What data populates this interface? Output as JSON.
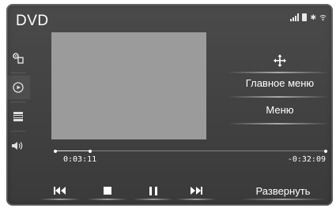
{
  "header": {
    "title": "DVD"
  },
  "status_icons": [
    "signal-icon",
    "battery-icon",
    "bluetooth-icon",
    "wifi-icon"
  ],
  "sidebar": {
    "items": [
      {
        "icon": "source-settings-icon",
        "active": false
      },
      {
        "icon": "play-disc-icon",
        "active": true
      },
      {
        "icon": "equalizer-icon",
        "active": false
      },
      {
        "icon": "volume-icon",
        "active": false
      }
    ]
  },
  "menu": {
    "move_icon": "move-arrows-icon",
    "main_menu_label": "Главное меню",
    "menu_label": "Меню"
  },
  "playback": {
    "elapsed": "0:03:11",
    "remaining": "-0:32:09",
    "progress_fraction": 0.13
  },
  "controls": {
    "prev_icon": "previous-track-icon",
    "stop_icon": "stop-icon",
    "pause_icon": "pause-icon",
    "next_icon": "next-track-icon",
    "expand_label": "Развернуть"
  },
  "colors": {
    "background": "#3f3f3f",
    "video_area": "#9b9b9b",
    "text": "#ffffff"
  }
}
